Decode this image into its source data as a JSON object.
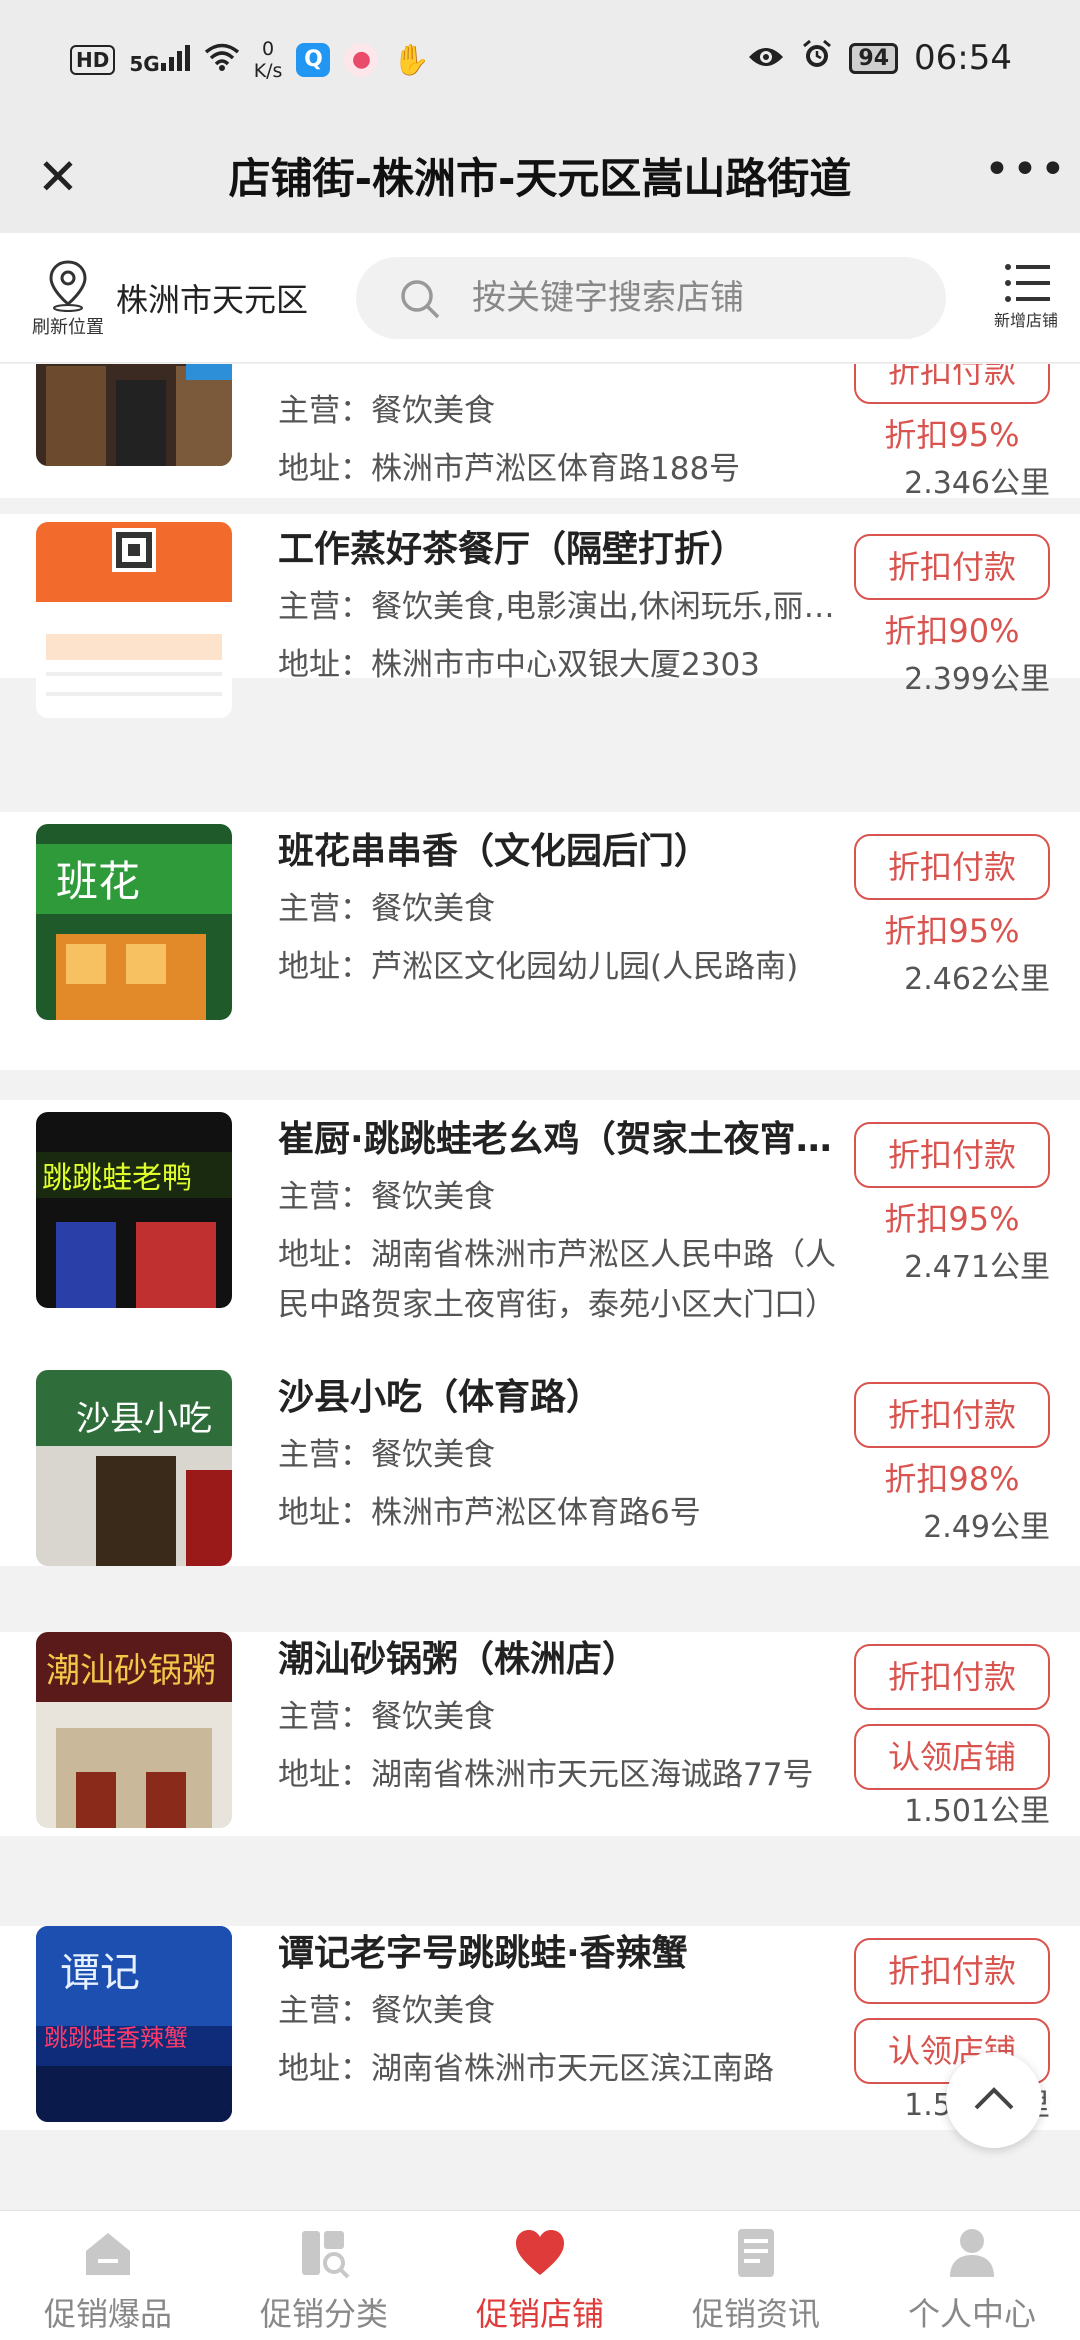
{
  "status_bar": {
    "hd": "HD",
    "net": "5G",
    "speed_value": "0",
    "speed_unit": "K/s",
    "battery": "94",
    "time": "06:54"
  },
  "header": {
    "title": "店铺街-株洲市-天元区嵩山路街道",
    "more": "•••"
  },
  "toolbar": {
    "refresh_label": "刷新位置",
    "city": "株洲市天元区",
    "search_placeholder": "按关键字搜索店铺",
    "add_shop_label": "新增店铺"
  },
  "stores": [
    {
      "name": "",
      "main": "主营：餐饮美食",
      "address": "地址：株洲市芦淞区体育路188号",
      "pay": "折扣付款",
      "discount": "折扣95%",
      "distance": "2.346公里"
    },
    {
      "name": "工作蒸好茶餐厅（隔壁打折）",
      "main": "主营：餐饮美食,电影演出,休闲玩乐,丽人美发,其他",
      "address": "地址：株洲市市中心双银大厦2303",
      "pay": "折扣付款",
      "discount": "折扣90%",
      "distance": "2.399公里"
    },
    {
      "name": "班花串串香（文化园后门）",
      "main": "主营：餐饮美食",
      "address": "地址：芦淞区文化园幼儿园(人民路南)",
      "pay": "折扣付款",
      "discount": "折扣95%",
      "distance": "2.462公里"
    },
    {
      "name": "崔厨·跳跳蛙老幺鸡（贺家土夜宵街）",
      "main": "主营：餐饮美食",
      "address": "地址：湖南省株洲市芦淞区人民中路（人民中路贺家土夜宵街，泰苑小区大门口）",
      "pay": "折扣付款",
      "discount": "折扣95%",
      "distance": "2.471公里"
    },
    {
      "name": "沙县小吃（体育路）",
      "main": "主营：餐饮美食",
      "address": "地址：株洲市芦淞区体育路6号",
      "pay": "折扣付款",
      "discount": "折扣98%",
      "distance": "2.49公里"
    },
    {
      "name": "潮汕砂锅粥（株洲店）",
      "main": "主营：餐饮美食",
      "address": "地址：湖南省株洲市天元区海诚路77号",
      "pay": "折扣付款",
      "claim": "认领店铺",
      "distance": "1.501公里"
    },
    {
      "name": "谭记老字号跳跳蛙·香辣蟹",
      "main": "主营：餐饮美食",
      "address": "地址：湖南省株洲市天元区滨江南路",
      "pay": "折扣付款",
      "claim": "认领店铺",
      "distance": "1.534公里"
    }
  ],
  "nav": [
    {
      "label": "促销爆品",
      "icon": "home-icon"
    },
    {
      "label": "促销分类",
      "icon": "category-icon"
    },
    {
      "label": "促销店铺",
      "icon": "heart-icon",
      "active": true
    },
    {
      "label": "促销资讯",
      "icon": "news-icon"
    },
    {
      "label": "个人中心",
      "icon": "user-icon"
    }
  ],
  "colors": {
    "accent": "#d9534f",
    "active_nav": "#e03b3b"
  }
}
